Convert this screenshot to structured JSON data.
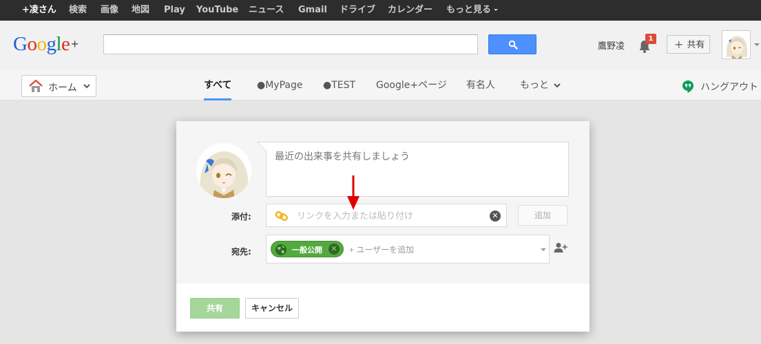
{
  "topbar": {
    "items": [
      {
        "label": "+凌さん"
      },
      {
        "label": "検索"
      },
      {
        "label": "画像"
      },
      {
        "label": "地図"
      },
      {
        "label": "Play"
      },
      {
        "label": "YouTube"
      },
      {
        "label": "ニュース"
      },
      {
        "label": "Gmail"
      },
      {
        "label": "ドライブ"
      },
      {
        "label": "カレンダー"
      },
      {
        "label": "もっと見る"
      }
    ]
  },
  "header": {
    "logo": {
      "letters": [
        "G",
        "o",
        "o",
        "g",
        "l",
        "e"
      ],
      "plus": "+",
      "colors": [
        "#1a61d9",
        "#dd2a1f",
        "#f5b400",
        "#1a61d9",
        "#139b3f",
        "#dd2a1f"
      ]
    },
    "search": {
      "value": "",
      "placeholder": ""
    },
    "search_icon": "search-icon",
    "user_name": "鷹野凌",
    "notifications": {
      "count": "1",
      "icon": "bell-icon"
    },
    "share_button": {
      "plus": "+",
      "label": "共有"
    }
  },
  "nav": {
    "home_label": "ホーム",
    "tabs": [
      {
        "label": "すべて"
      },
      {
        "label": "●MyPage"
      },
      {
        "label": "●TEST"
      },
      {
        "label": "Google+ページ"
      },
      {
        "label": "有名人"
      },
      {
        "label": "もっと"
      }
    ],
    "hangout_label": "ハングアウト"
  },
  "dialog": {
    "post_placeholder": "最近の出来事を共有しましょう",
    "attach_label": "添付:",
    "attach_placeholder": "リンクを入力または貼り付け",
    "add_button": "追加",
    "dest_label": "宛先:",
    "public_chip": "一般公開",
    "add_user_placeholder": "+ ユーザーを追加",
    "share_button": "共有",
    "cancel_button": "キャンセル"
  },
  "colors": {
    "topbar_bg": "#2d2d2d",
    "accent_blue": "#4d90fe",
    "chip_green": "#53a93f",
    "badge_red": "#dd4b39",
    "arrow_red": "#e00000"
  }
}
